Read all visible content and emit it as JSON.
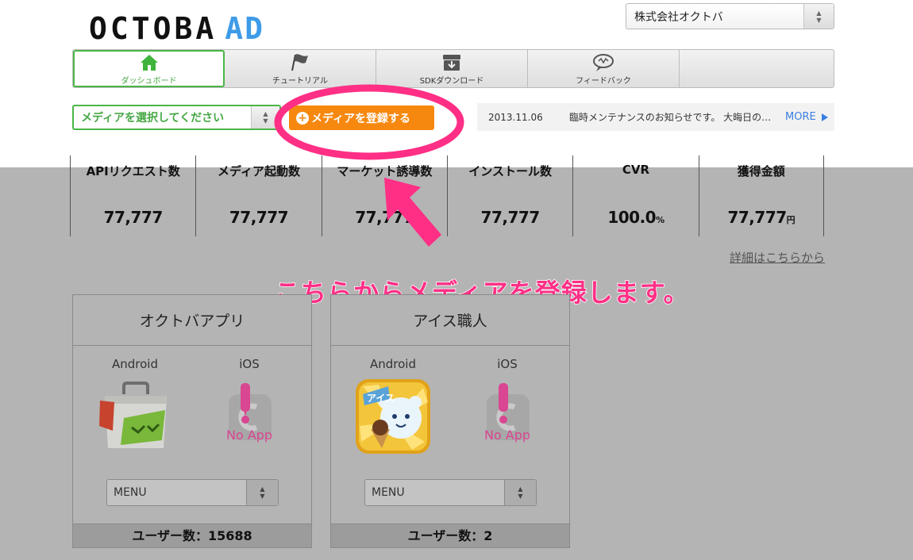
{
  "header": {
    "logo_main": "OCTOBA",
    "logo_accent": "AD",
    "company_select_value": "株式会社オクトバ"
  },
  "nav": {
    "tabs": [
      {
        "label": "ダッシュボード",
        "icon": "home-icon",
        "active": true
      },
      {
        "label": "チュートリアル",
        "icon": "flag-icon",
        "active": false
      },
      {
        "label": "SDKダウンロード",
        "icon": "download-box-icon",
        "active": false
      },
      {
        "label": "フィードバック",
        "icon": "speech-bubble-icon",
        "active": false
      }
    ]
  },
  "toolbar": {
    "media_select_value": "メディアを選択してください",
    "register_label": "メディアを登録する"
  },
  "news": {
    "date": "2013.11.06",
    "message": "臨時メンテナンスのお知らせです。 大晦日の…",
    "more_label": "MORE"
  },
  "stats": [
    {
      "label": "APIリクエスト数",
      "value": "77,777",
      "unit": ""
    },
    {
      "label": "メディア起動数",
      "value": "77,777",
      "unit": ""
    },
    {
      "label": "マーケット誘導数",
      "value": "77,777",
      "unit": ""
    },
    {
      "label": "インストール数",
      "value": "77,777",
      "unit": ""
    },
    {
      "label": "CVR",
      "value": "100.0",
      "unit": "%"
    },
    {
      "label": "獲得金額",
      "value": "77,777",
      "unit": "円"
    }
  ],
  "details_link": "詳細はこちらから",
  "annotation": "こちらからメディアを登録します。",
  "apps": [
    {
      "name": "オクトバアプリ",
      "android_label": "Android",
      "ios_label": "iOS",
      "ios_noapp": "No App",
      "menu_label": "MENU",
      "users_label": "ユーザー数：",
      "users_value": "15688"
    },
    {
      "name": "アイス職人",
      "android_label": "Android",
      "ios_label": "iOS",
      "ios_noapp": "No App",
      "menu_label": "MENU",
      "users_label": "ユーザー数：",
      "users_value": "2"
    }
  ],
  "colors": {
    "accent_green": "#4ab548",
    "register_orange": "#f7880f",
    "link_blue": "#3b7fe0",
    "annotation_pink": "#ff2f86",
    "overlay_gray": "#b4b4b4"
  }
}
